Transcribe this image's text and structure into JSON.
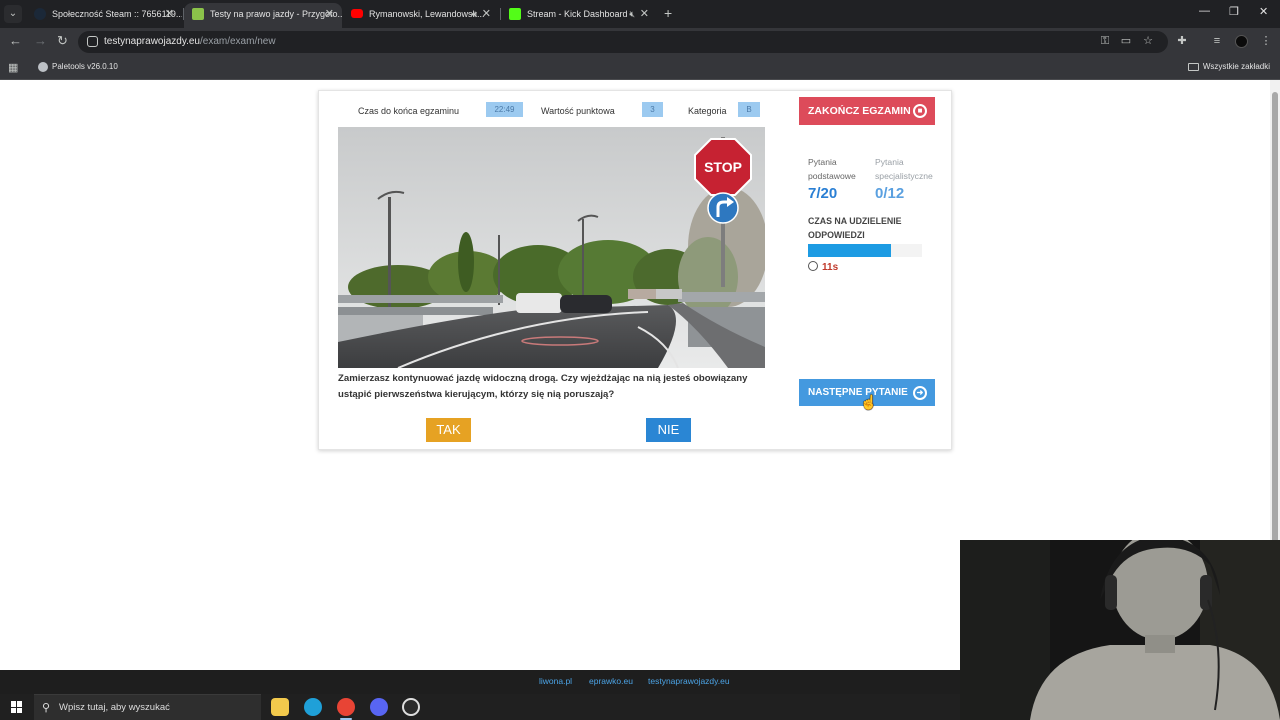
{
  "browser": {
    "tabs": [
      {
        "title": "Społeczność Steam :: 7656119...",
        "favicon_color": "#1b2838",
        "active": false
      },
      {
        "title": "Testy na prawo jazdy - Przygoto...",
        "favicon_color": "#8bc34a",
        "active": true
      },
      {
        "title": "Rymanowski, Lewandowsk...",
        "favicon_color": "#ff0000",
        "active": false,
        "audio": "playing"
      },
      {
        "title": "Stream - Kick Dashboard",
        "favicon_color": "#53fc18",
        "active": false,
        "audio": "muted"
      }
    ],
    "url_domain": "testynaprawojazdy.eu",
    "url_path": "/exam/exam/new",
    "bookmarks": [
      {
        "label": "Paletools v26.0.10"
      }
    ],
    "all_bookmarks_label": "Wszystkie zakładki"
  },
  "exam": {
    "time_left_label": "Czas do końca egzaminu",
    "time_left_value": "22:49",
    "points_label": "Wartość punktowa",
    "points_value": "3",
    "category_label": "Kategoria",
    "category_value": "B",
    "end_button_label": "ZAKOŃCZ EGZAMIN",
    "basic_questions_label": "Pytania podstawowe",
    "basic_questions_value": "7/20",
    "special_questions_label": "Pytania specjalistyczne",
    "special_questions_value": "0/12",
    "answer_time_label": "CZAS NA UDZIELENIE ODPOWIEDZI",
    "answer_time_progress": 0.73,
    "answer_time_remaining": "11s",
    "question_text": "Zamierzasz kontynuować jazdę widoczną drogą. Czy wjeżdżając na nią jesteś obowiązany ustąpić pierwszeństwa kierującym, którzy się nią poruszają?",
    "yes_label": "TAK",
    "no_label": "NIE",
    "next_button_label": "NASTĘPNE PYTANIE",
    "sign_text": "STOP"
  },
  "footer": {
    "links": [
      "liwona.pl",
      "eprawko.eu",
      "testynaprawojazdy.eu"
    ]
  },
  "taskbar": {
    "search_placeholder": "Wpisz tutaj, aby wyszukać",
    "apps": [
      {
        "name": "file-explorer-icon",
        "color": "#f2c94c"
      },
      {
        "name": "edge-icon",
        "color": "#1fa0d8"
      },
      {
        "name": "chrome-icon",
        "color": "#e84435"
      },
      {
        "name": "discord-icon",
        "color": "#5865f2"
      },
      {
        "name": "obs-icon",
        "color": "#2b2b2b"
      }
    ]
  }
}
